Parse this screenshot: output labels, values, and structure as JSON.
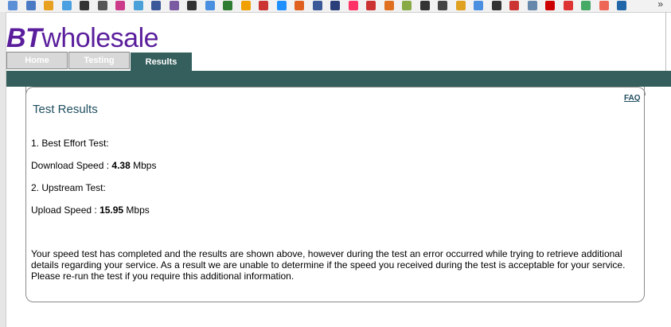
{
  "bookmarks": {
    "icons": [
      "#5b8fd6",
      "#4a7ac4",
      "#e8a020",
      "#4aa0e0",
      "#333333",
      "#555555",
      "#cc3b8a",
      "#4aa0d8",
      "#3b5998",
      "#7a5aa0",
      "#333333",
      "#4a8fe0",
      "#2e7d32",
      "#f0a000",
      "#cc3333",
      "#1e90ff",
      "#e06020",
      "#3b5998",
      "#2a3f7a",
      "#ff3366",
      "#cc3333",
      "#e07020",
      "#88aa44",
      "#333333",
      "#444444",
      "#e0a020",
      "#4a8fe0",
      "#333333",
      "#cc3333",
      "#6688aa",
      "#cc0000",
      "#dd3333",
      "#44aa66",
      "#ee6655",
      "#2266aa"
    ],
    "more_label": "»"
  },
  "logo": {
    "bt": "BT",
    "wholesale": "wholesale"
  },
  "tabs": {
    "home": "Home",
    "testing": "Testing",
    "results": "Results"
  },
  "panel": {
    "faq": "FAQ",
    "title": "Test Results",
    "best_effort_heading": "1. Best Effort Test:",
    "download_label": "Download Speed : ",
    "download_value": "4.38",
    "download_unit": " Mbps",
    "upstream_heading": "2. Upstream Test:",
    "upload_label": "Upload Speed : ",
    "upload_value": "15.95",
    "upload_unit": " Mbps",
    "note": "Your speed test has completed and the results are shown above, however during the test an error occurred while trying to retrieve additional details regarding your service. As a result we are unable to determine if the speed you received during the test is acceptable for your service. Please re-run the test if you require this additional information."
  }
}
